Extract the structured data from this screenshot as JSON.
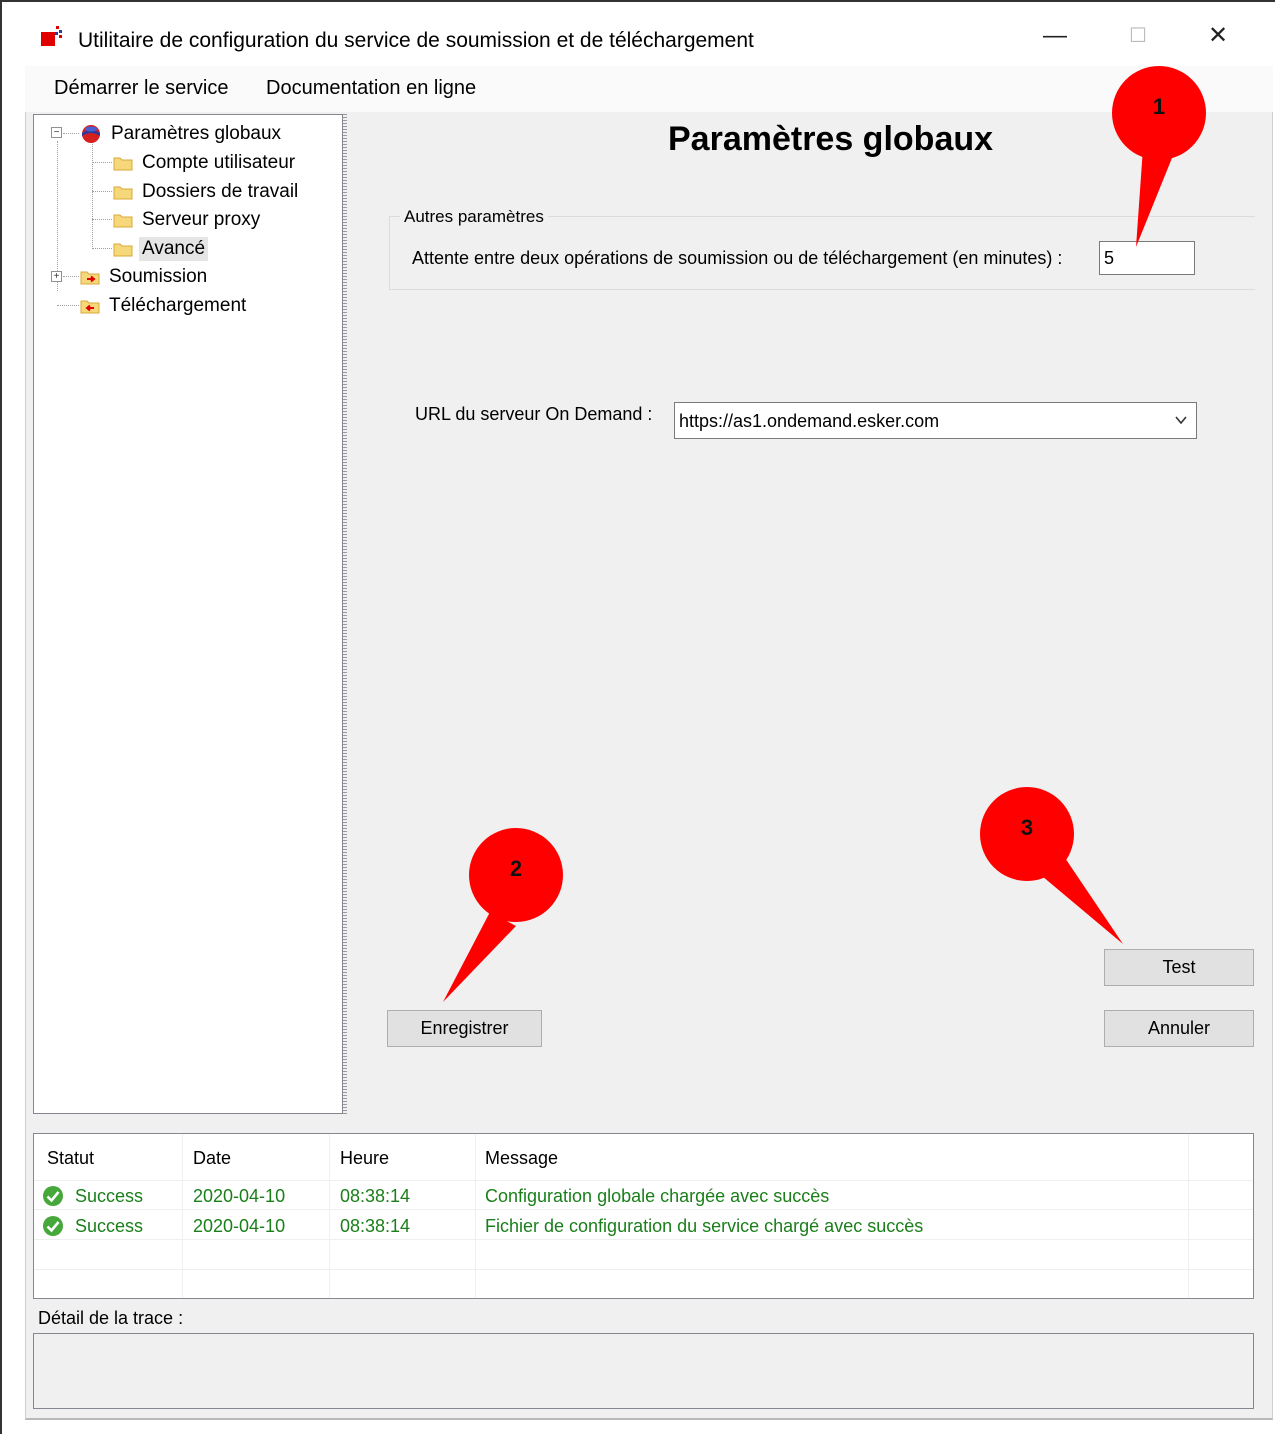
{
  "window": {
    "title": "Utilitaire de configuration du service de soumission et de téléchargement",
    "minimize": "—",
    "maximize": "☐",
    "close": "✕"
  },
  "menu": {
    "items": [
      "Démarrer le service",
      "Documentation en ligne"
    ]
  },
  "tree": {
    "root": "Paramètres globaux",
    "children": [
      "Compte utilisateur",
      "Dossiers de travail",
      "Serveur proxy",
      "Avancé"
    ],
    "selected": "Avancé",
    "submission": "Soumission",
    "download": "Téléchargement"
  },
  "main": {
    "title": "Paramètres globaux",
    "group_title": "Autres paramètres",
    "wait_label": "Attente entre deux opérations de soumission ou de téléchargement (en minutes) :",
    "wait_value": "5",
    "url_label": "URL du serveur On Demand :",
    "url_value": "https://as1.ondemand.esker.com",
    "save_button": "Enregistrer",
    "test_button": "Test",
    "cancel_button": "Annuler"
  },
  "log": {
    "headers": [
      "Statut",
      "Date",
      "Heure",
      "Message"
    ],
    "rows": [
      {
        "status": "Success",
        "date": "2020-04-10",
        "time": "08:38:14",
        "message": "Configuration globale chargée avec succès"
      },
      {
        "status": "Success",
        "date": "2020-04-10",
        "time": "08:38:14",
        "message": "Fichier de configuration du service chargé avec succès"
      }
    ],
    "status_color": "#1a7f1a"
  },
  "trace": {
    "label": "Détail de la trace :"
  },
  "callouts": [
    "1",
    "2",
    "3"
  ],
  "colors": {
    "callout": "#ff0000",
    "window_bg": "#f0f0f0"
  }
}
